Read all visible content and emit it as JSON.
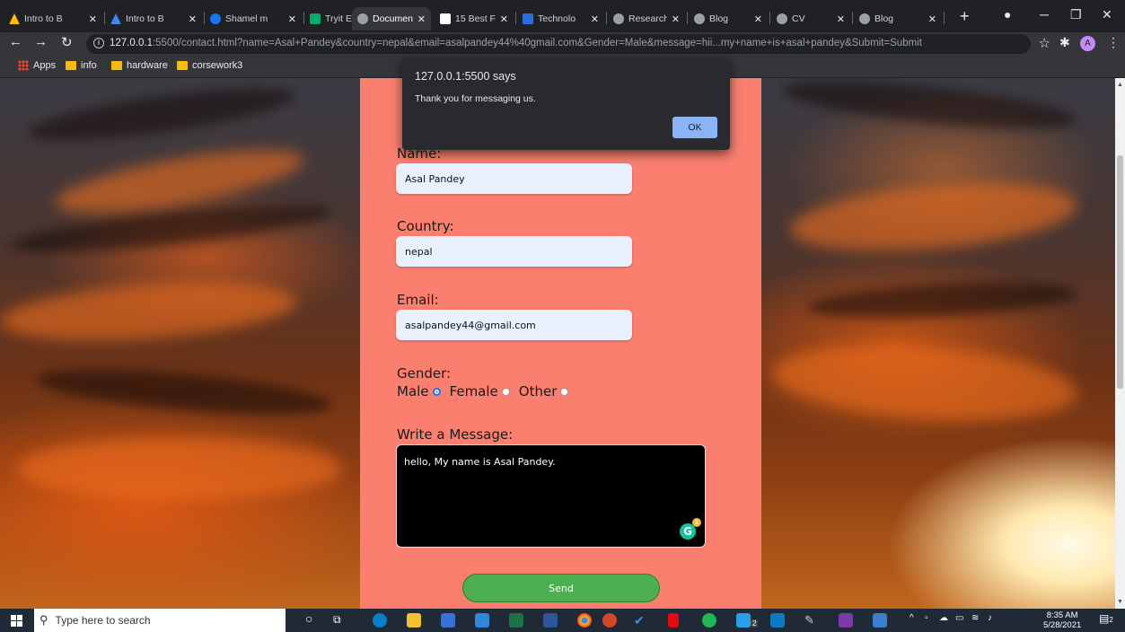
{
  "browser": {
    "tabs": [
      {
        "label": "Intro to B",
        "favicon_color": "#fbbc04"
      },
      {
        "label": "Intro to B",
        "favicon_color": "#4285f4"
      },
      {
        "label": "Shamel m",
        "favicon_color": "#1877f2"
      },
      {
        "label": "Tryit Edito",
        "favicon_color": "#04aa6d"
      },
      {
        "label": "Documen",
        "favicon_color": "#9aa0a6"
      },
      {
        "label": "15 Best F",
        "favicon_color": "#ffffff"
      },
      {
        "label": "Technolo",
        "favicon_color": "#2d6cdf"
      },
      {
        "label": "Research",
        "favicon_color": "#9aa0a6"
      },
      {
        "label": "Blog",
        "favicon_color": "#9aa0a6"
      },
      {
        "label": "CV",
        "favicon_color": "#9aa0a6"
      },
      {
        "label": "Blog",
        "favicon_color": "#9aa0a6"
      }
    ],
    "url": "127.0.0.1:5500/contact.html?name=Asal+Pandey&country=nepal&email=asalpandey44%40gmail.com&Gender=Male&message=hii...my+name+is+asal+pandey&Submit=Submit",
    "url_host": "127.0.0.1",
    "url_rest": ":5500/contact.html?name=Asal+Pandey&country=nepal&email=asalpandey44%40gmail.com&Gender=Male&message=hii...my+name+is+asal+pandey&Submit=Submit",
    "profile_initial": "A",
    "bookmarks": [
      {
        "label": "Apps",
        "icon": "apps-grid-icon"
      },
      {
        "label": "info",
        "icon": "folder-icon"
      },
      {
        "label": "hardware",
        "icon": "folder-icon"
      },
      {
        "label": "corsework3",
        "icon": "folder-icon"
      }
    ]
  },
  "dialog": {
    "title": "127.0.0.1:5500 says",
    "message": "Thank you for messaging us.",
    "ok_label": "OK"
  },
  "form": {
    "name_label": "Name:",
    "name_value": "Asal Pandey",
    "country_label": "Country:",
    "country_value": "nepal",
    "email_label": "Email:",
    "email_value": "asalpandey44@gmail.com",
    "gender_label": "Gender:",
    "gender_options": [
      {
        "label": "Male",
        "checked": true
      },
      {
        "label": "Female",
        "checked": false
      },
      {
        "label": "Other",
        "checked": false
      }
    ],
    "message_label": "Write a Message:",
    "message_value": "hello, My name is Asal Pandey.",
    "grammarly_badge": "1",
    "send_label": "Send",
    "panel_color": "#fa7f6f",
    "send_color": "#4caf50"
  },
  "taskbar": {
    "search_placeholder": "Type here to search",
    "time": "8:35 AM",
    "date": "5/28/2021",
    "notification_count": "2",
    "vscode_badge": "2"
  }
}
